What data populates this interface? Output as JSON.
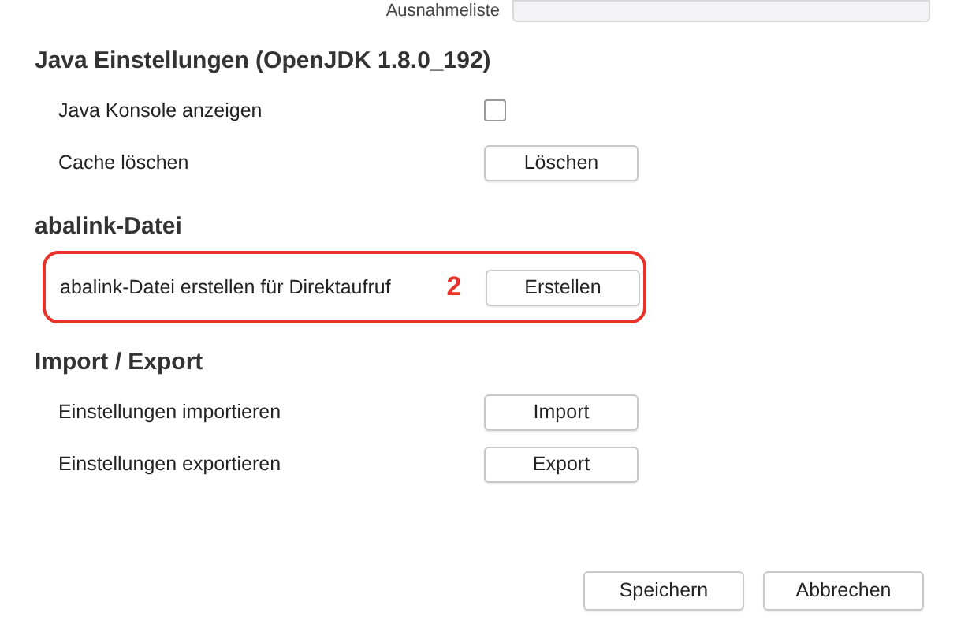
{
  "top_field": {
    "label": "Ausnahmeliste"
  },
  "sections": [
    {
      "title": "Java Einstellungen (OpenJDK 1.8.0_192)",
      "rows": [
        {
          "kind": "checkbox",
          "label": "Java Konsole anzeigen",
          "checked": false
        },
        {
          "kind": "button",
          "label": "Cache löschen",
          "button": "Löschen"
        }
      ]
    },
    {
      "title": "abalink-Datei",
      "rows": [
        {
          "kind": "button",
          "label": "abalink-Datei erstellen für Direktaufruf",
          "button": "Erstellen",
          "callout": "2"
        }
      ]
    },
    {
      "title": "Import / Export",
      "rows": [
        {
          "kind": "button",
          "label": "Einstellungen importieren",
          "button": "Import"
        },
        {
          "kind": "button",
          "label": "Einstellungen exportieren",
          "button": "Export"
        }
      ]
    }
  ],
  "buttons": [
    "Speichern",
    "Abbrechen"
  ]
}
